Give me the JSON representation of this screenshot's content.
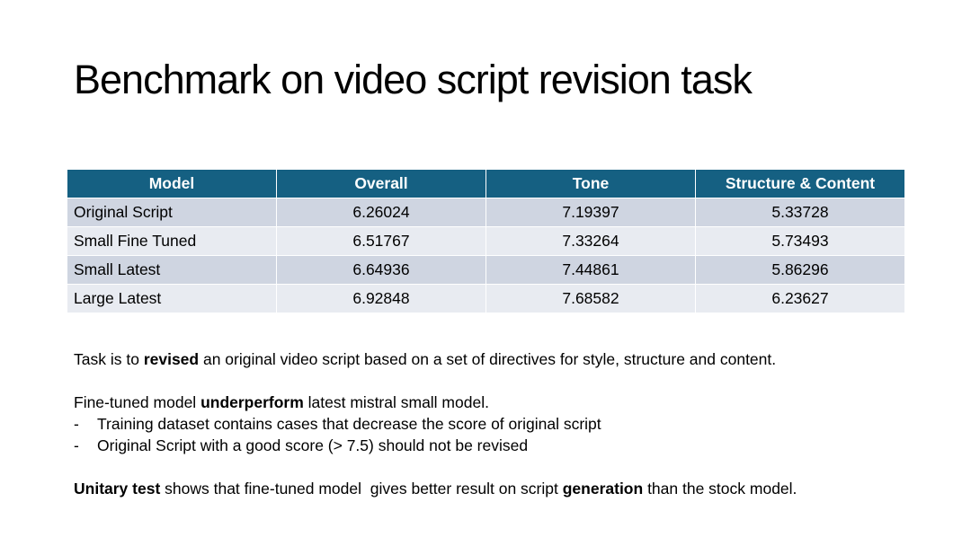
{
  "title": "Benchmark on video script revision task",
  "table": {
    "headers": [
      "Model",
      "Overall",
      "Tone",
      "Structure & Content"
    ],
    "rows": [
      {
        "model": "Original Script",
        "overall": "6.26024",
        "tone": "7.19397",
        "structure": "5.33728"
      },
      {
        "model": "Small Fine Tuned",
        "overall": "6.51767",
        "tone": "7.33264",
        "structure": "5.73493"
      },
      {
        "model": "Small Latest",
        "overall": "6.64936",
        "tone": "7.44861",
        "structure": "5.86296"
      },
      {
        "model": "Large Latest",
        "overall": "6.92848",
        "tone": "7.68582",
        "structure": "6.23627"
      }
    ],
    "header_color": "#156082",
    "row_colors": [
      "#cfd5e1",
      "#e8ebf1"
    ]
  },
  "notes": {
    "task": {
      "pre": "Task is to ",
      "bold": "revised",
      "post": " an original video script based on a set of directives for style, structure and content."
    },
    "finetune": {
      "pre": "Fine-tuned model ",
      "bold": "underperform",
      "post": " latest mistral small model."
    },
    "bullets": [
      {
        "dash": "-",
        "text": "Training dataset contains cases that decrease the score of original script"
      },
      {
        "dash": "-",
        "text": "Original Script with a good score (> 7.5) should not be revised"
      }
    ],
    "unitary": {
      "bold1": "Unitary test",
      "mid": " shows that fine-tuned model  gives better result on script ",
      "bold2": "generation",
      "post": " than the stock model."
    }
  }
}
